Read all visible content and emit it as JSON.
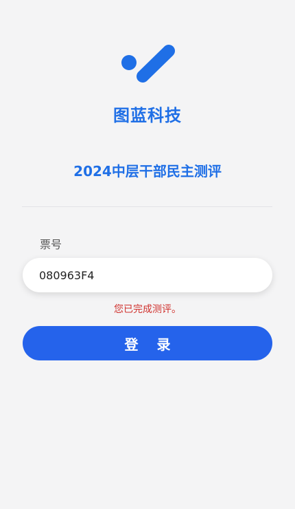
{
  "brand": {
    "company_name": "图蓝科技",
    "logo_icon": "brand-logo-icon",
    "color": "#1f6fe6"
  },
  "page": {
    "title": "2024中层干部民主测评"
  },
  "form": {
    "ticket_label": "票号",
    "ticket_value": "080963F4",
    "error_message": "您已完成测评。",
    "login_label": "登 录"
  },
  "colors": {
    "primary": "#2563eb",
    "error": "#d0312d",
    "background": "#f4f4f5"
  }
}
